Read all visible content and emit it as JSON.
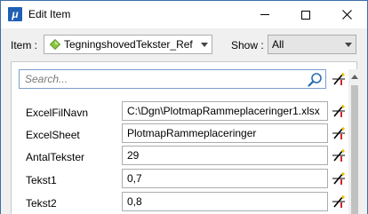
{
  "window": {
    "title": "Edit Item",
    "app_icon_letter": "μ",
    "controls": {
      "minimize": "minimize-icon",
      "maximize": "maximize-icon",
      "close": "close-icon"
    }
  },
  "toolbar": {
    "item_label": "Item :",
    "item_value": "TegningshovedTekster_Ref",
    "item_icon": "diamond-icon",
    "show_label": "Show :",
    "show_value": "All"
  },
  "search": {
    "placeholder": "Search...",
    "icon": "search-icon"
  },
  "properties": [
    {
      "label": "ExcelFilNavn",
      "value": "C:\\Dgn\\PlotmapRammeplaceringer1.xlsx"
    },
    {
      "label": "ExcelSheet",
      "value": "PlotmapRammeplaceringer"
    },
    {
      "label": "AntalTekster",
      "value": "29"
    },
    {
      "label": "Tekst1",
      "value": "0,7"
    },
    {
      "label": "Tekst2",
      "value": "0,8"
    }
  ],
  "colors": {
    "accent": "#1f5fb5",
    "edit_icon_red": "#d4262a",
    "edit_icon_yellow": "#f0c000"
  }
}
